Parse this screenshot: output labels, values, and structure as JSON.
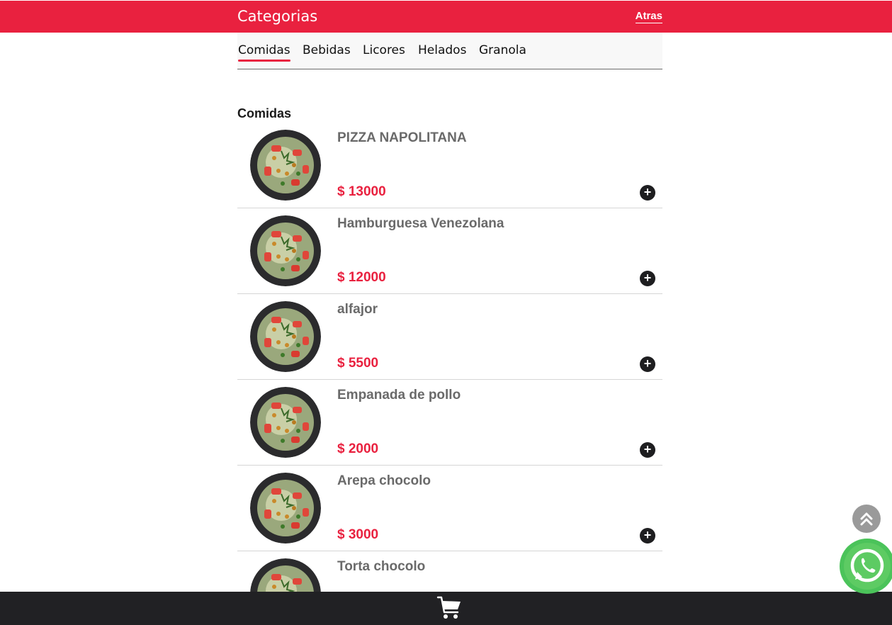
{
  "header": {
    "title": "Categorias",
    "back_label": "Atras"
  },
  "tabs": [
    {
      "label": "Comidas",
      "active": true
    },
    {
      "label": "Bebidas",
      "active": false
    },
    {
      "label": "Licores",
      "active": false
    },
    {
      "label": "Helados",
      "active": false
    },
    {
      "label": "Granola",
      "active": false
    }
  ],
  "section": {
    "title": "Comidas"
  },
  "products": [
    {
      "name": "PIZZA NAPOLITANA",
      "price": "$ 13000",
      "add_icon": "plus-icon"
    },
    {
      "name": "Hamburguesa Venezolana",
      "price": "$ 12000",
      "add_icon": "plus-icon"
    },
    {
      "name": "alfajor",
      "price": "$ 5500",
      "add_icon": "plus-icon"
    },
    {
      "name": "Empanada de pollo",
      "price": "$ 2000",
      "add_icon": "plus-icon"
    },
    {
      "name": "Arepa chocolo",
      "price": "$ 3000",
      "add_icon": "plus-icon"
    },
    {
      "name": "Torta chocolo",
      "price": "",
      "add_icon": "plus-icon"
    }
  ],
  "footer": {
    "icon": "shopping-cart-icon"
  },
  "floating": {
    "scroll_top_icon": "double-chevron-up-icon",
    "whatsapp_icon": "whatsapp-icon"
  },
  "colors": {
    "brand": "#e9213f",
    "footer": "#212124",
    "whatsapp": "#4bc35a"
  }
}
